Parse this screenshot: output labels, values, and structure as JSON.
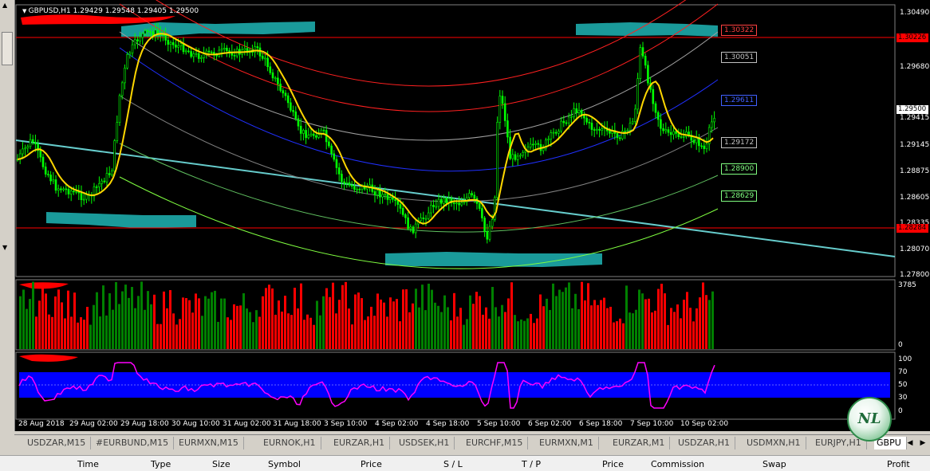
{
  "chart": {
    "title": "GBPUSD,H1  1.29429 1.29548 1.29405 1.29500",
    "price_labels": [
      "1.30490",
      "1.30226",
      "1.29680",
      "1.29500",
      "1.29415",
      "1.29145",
      "1.28875",
      "1.28605",
      "1.28335",
      "1.28284",
      "1.28070",
      "1.27800"
    ],
    "level_tags": [
      "1.30322",
      "1.30051",
      "1.29611",
      "1.29172",
      "1.28900",
      "1.28629"
    ],
    "volume_scale": {
      "max": "3785",
      "min": "0"
    },
    "rsi_scale": [
      "100",
      "70",
      "50",
      "30",
      "0"
    ],
    "time_labels": [
      "28 Aug 2018",
      "29 Aug 02:00",
      "29 Aug 18:00",
      "30 Aug 10:00",
      "31 Aug 02:00",
      "31 Aug 18:00",
      "3 Sep 10:00",
      "4 Sep 02:00",
      "4 Sep 18:00",
      "5 Sep 10:00",
      "6 Sep 02:00",
      "6 Sep 18:00",
      "7 Sep 10:00",
      "10 Sep 02:00"
    ]
  },
  "tabs": [
    "USDZAR,M15",
    "#EURBUND,M15",
    "EURMXN,M15",
    "EURNOK,H1",
    "EURZAR,H1",
    "USDSEK,H1",
    "EURCHF,M15",
    "EURMXN,M1",
    "EURZAR,M1",
    "USDZAR,H1",
    "USDMXN,H1",
    "EURJPY,H1",
    "GBPU"
  ],
  "terminal_columns": [
    "Time",
    "Type",
    "Size",
    "Symbol",
    "Price",
    "S / L",
    "T / P",
    "Price",
    "Commission",
    "Swap",
    "Profit"
  ],
  "logo_text": "NL",
  "colors": {
    "candle": "#00ff00",
    "ma": "#ffd700",
    "volume_up": "#008000",
    "volume_down": "#ff0000",
    "rsi_fill": "#0000ff",
    "rsi_line": "#ff00ff",
    "trendline": "#66cccc",
    "zone": "#1a9a9a",
    "hline": "#ff0000"
  }
}
